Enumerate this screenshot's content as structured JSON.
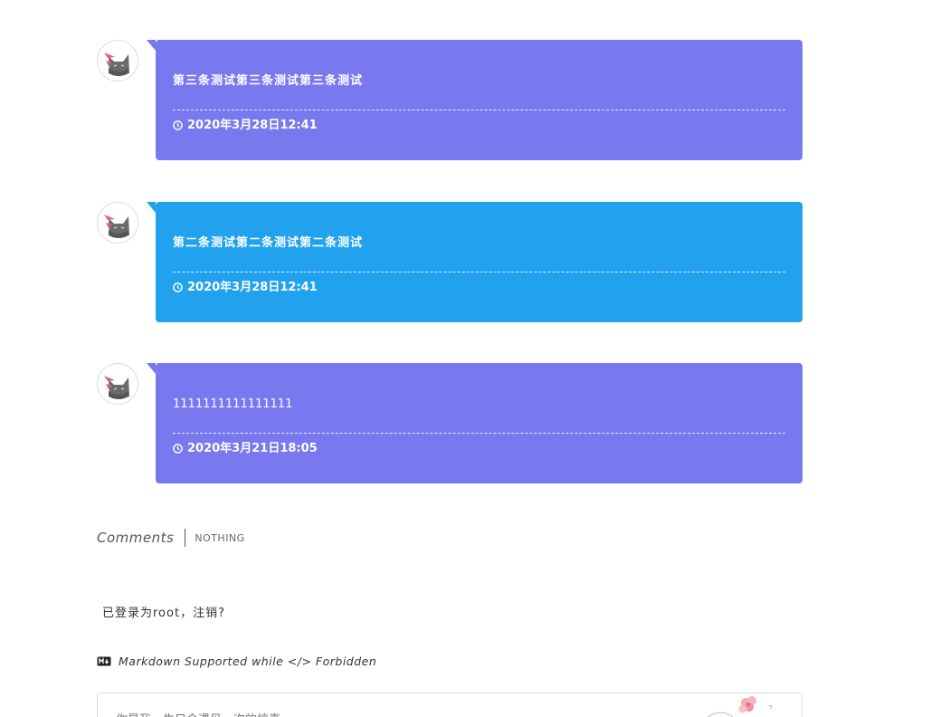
{
  "messages": [
    {
      "text": "第三条测试第三条测试第三条测试",
      "time": "2020年3月28日12:41",
      "color": "#7879ee"
    },
    {
      "text": "第二条测试第二条测试第二条测试",
      "time": "2020年3月28日12:41",
      "color": "#22a2ee"
    },
    {
      "text": "1111111111111111",
      "time": "2020年3月21日18:05",
      "color": "#7879ee"
    }
  ],
  "comments": {
    "title": "Comments",
    "subtitle": "NOTHING",
    "login_text": "已登录为root，注销?",
    "markdown_note": "Markdown Supported while </> Forbidden",
    "input_placeholder": "你是我一生只会遇见一次的惊喜..."
  }
}
